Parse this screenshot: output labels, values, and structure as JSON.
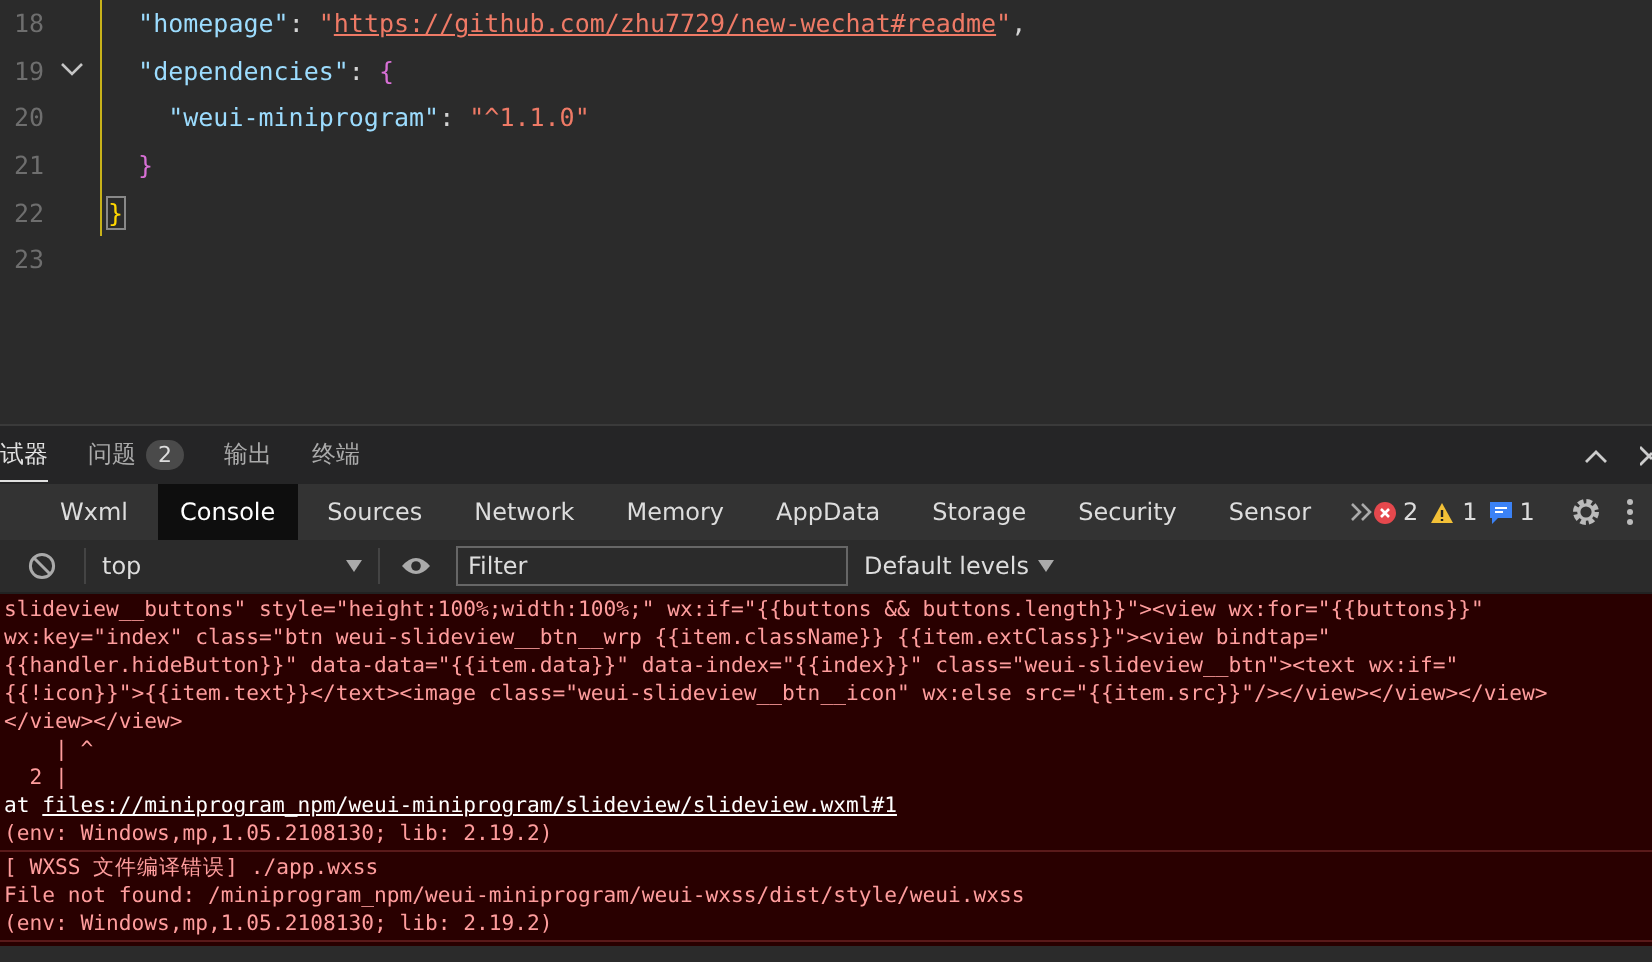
{
  "editor": {
    "lines": [
      {
        "number": "18",
        "foldable": false,
        "tokens": [
          {
            "text": "  \"homepage\"",
            "kind": "key"
          },
          {
            "text": ": ",
            "kind": "punct"
          },
          {
            "text": "\"",
            "kind": "string"
          },
          {
            "text": "https://github.com/zhu7729/new-wechat#readme",
            "kind": "link"
          },
          {
            "text": "\"",
            "kind": "string"
          },
          {
            "text": ",",
            "kind": "punct"
          }
        ]
      },
      {
        "number": "19",
        "foldable": true,
        "tokens": [
          {
            "text": "  \"dependencies\"",
            "kind": "key"
          },
          {
            "text": ": ",
            "kind": "punct"
          },
          {
            "text": "{",
            "kind": "brace"
          }
        ]
      },
      {
        "number": "20",
        "foldable": false,
        "tokens": [
          {
            "text": "    \"weui-miniprogram\"",
            "kind": "key"
          },
          {
            "text": ": ",
            "kind": "punct"
          },
          {
            "text": "\"^1.1.0\"",
            "kind": "string"
          }
        ]
      },
      {
        "number": "21",
        "foldable": false,
        "tokens": [
          {
            "text": "  }",
            "kind": "brace"
          }
        ]
      },
      {
        "number": "22",
        "foldable": false,
        "tokens": [
          {
            "text": "}",
            "kind": "outer-brace"
          }
        ]
      },
      {
        "number": "23",
        "foldable": false
      }
    ]
  },
  "panel_tabs": [
    {
      "label": "试器",
      "selected": true
    },
    {
      "label": "问题",
      "selected": false,
      "badge": "2"
    },
    {
      "label": "输出",
      "selected": false
    },
    {
      "label": "终端",
      "selected": false
    }
  ],
  "devtools_tabs": [
    {
      "label": "Wxml",
      "selected": false
    },
    {
      "label": "Console",
      "selected": true
    },
    {
      "label": "Sources",
      "selected": false
    },
    {
      "label": "Network",
      "selected": false
    },
    {
      "label": "Memory",
      "selected": false
    },
    {
      "label": "AppData",
      "selected": false
    },
    {
      "label": "Storage",
      "selected": false
    },
    {
      "label": "Security",
      "selected": false
    },
    {
      "label": "Sensor",
      "selected": false
    }
  ],
  "counts": {
    "errors": "2",
    "warnings": "1",
    "info": "1"
  },
  "toolbar": {
    "context": "top",
    "filter": {
      "placeholder": "Filter"
    },
    "levels": "Default levels"
  },
  "messages": [
    {
      "lines": [
        {
          "kind": "text",
          "text": "slideview__buttons\" style=\"height:100%;width:100%;\" wx:if=\"{{buttons && buttons.length}}\"><view wx:for=\"{{buttons}}\""
        },
        {
          "kind": "text",
          "text": "wx:key=\"index\" class=\"btn weui-slideview__btn__wrp {{item.className}} {{item.extClass}}\"><view bindtap=\""
        },
        {
          "kind": "text",
          "text": "{{handler.hideButton}}\" data-data=\"{{item.data}}\" data-index=\"{{index}}\" class=\"weui-slideview__btn\"><text wx:if=\""
        },
        {
          "kind": "text",
          "text": "{{!icon}}\">{{item.text}}</text><image class=\"weui-slideview__btn__icon\" wx:else src=\"{{item.src}}\"/></view></view></view>"
        },
        {
          "kind": "text",
          "text": "</view></view>"
        },
        {
          "kind": "text",
          "text": "    | ^"
        },
        {
          "kind": "text",
          "text": "  2 |"
        },
        {
          "kind": "location",
          "prefix": "at ",
          "link": "files://miniprogram_npm/weui-miniprogram/slideview/slideview.wxml#1"
        },
        {
          "kind": "env",
          "text": "(env: Windows,mp,1.05.2108130; lib: 2.19.2)"
        }
      ]
    },
    {
      "lines": [
        {
          "kind": "text",
          "text": "[ WXSS 文件编译错误] ./app.wxss"
        },
        {
          "kind": "text",
          "text": "File not found: /miniprogram_npm/weui-miniprogram/weui-wxss/dist/style/weui.wxss"
        },
        {
          "kind": "env",
          "text": "(env: Windows,mp,1.05.2108130; lib: 2.19.2)"
        }
      ]
    }
  ]
}
